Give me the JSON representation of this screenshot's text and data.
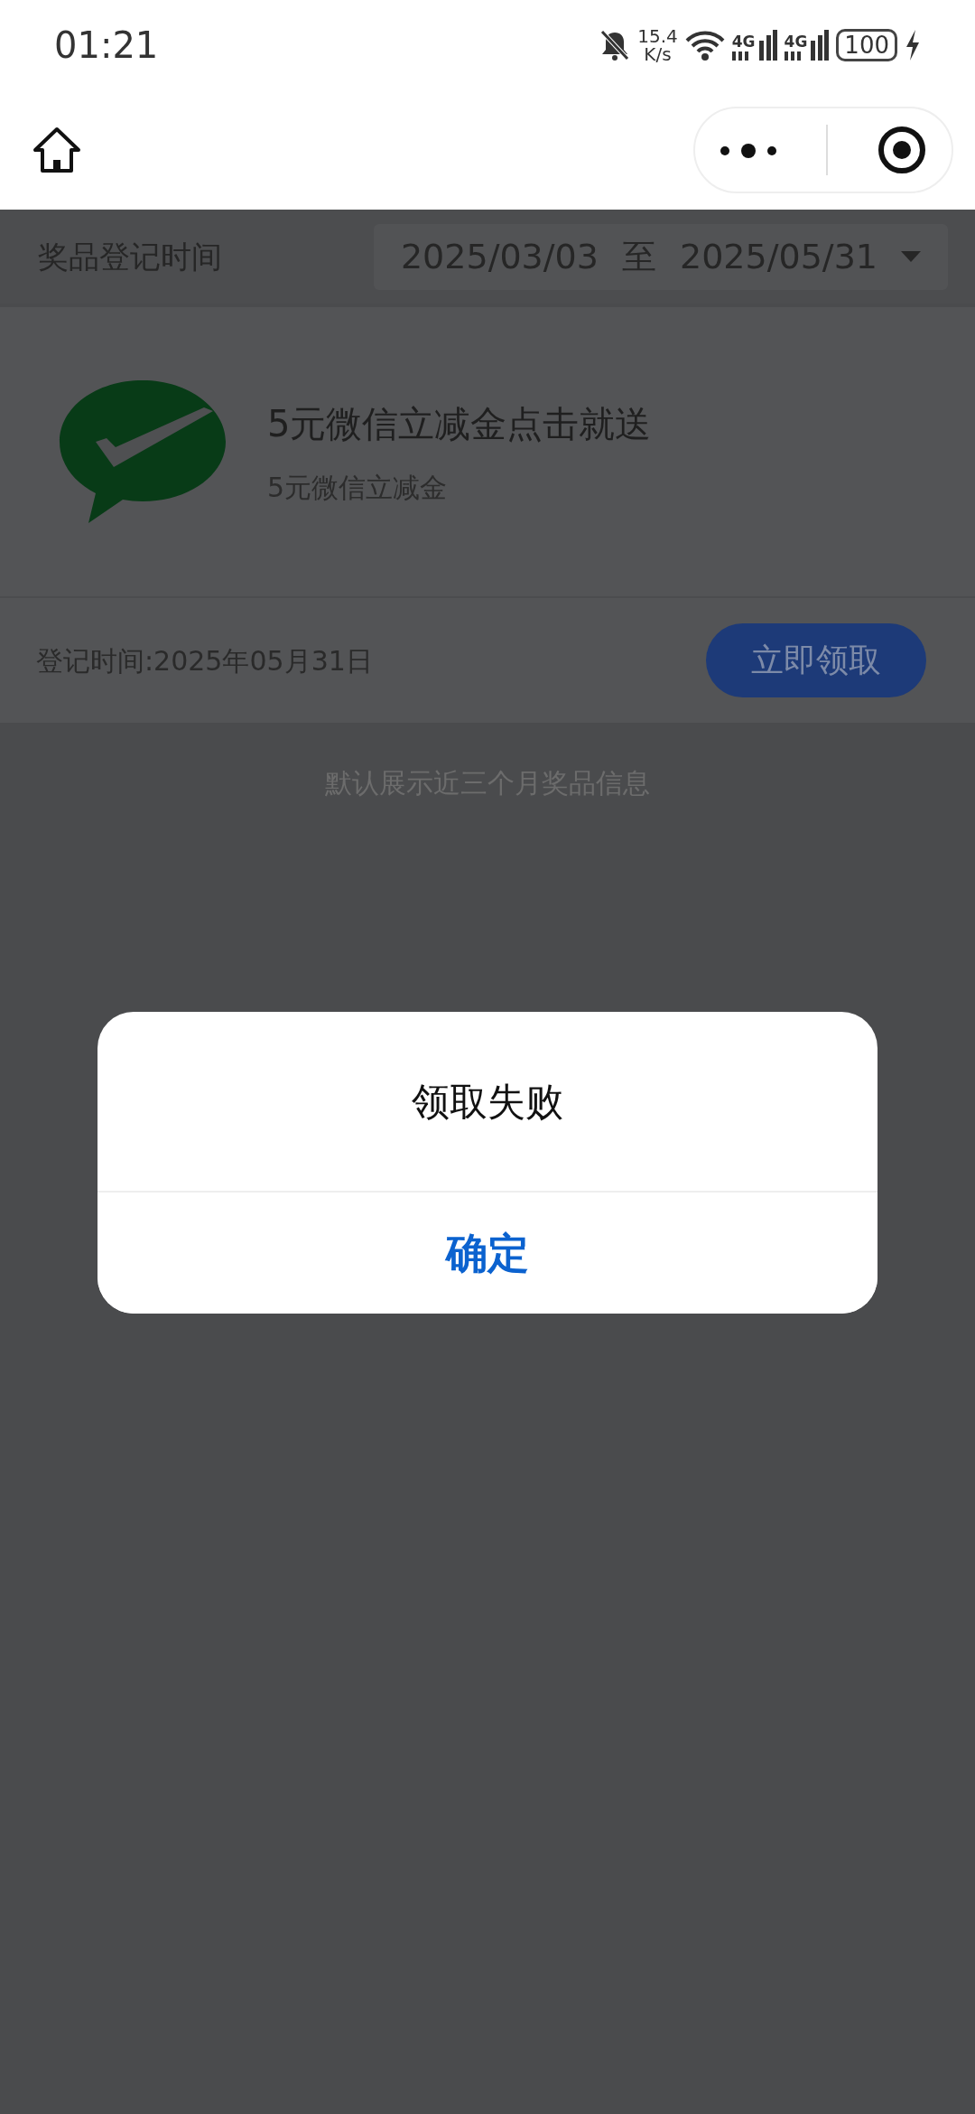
{
  "status_bar": {
    "time": "01:21",
    "net_speed": "15.4",
    "net_speed_unit": "K/s",
    "sim_1": "4G",
    "sim_2": "4G",
    "battery": "100"
  },
  "filter": {
    "label": "奖品登记时间",
    "start": "2025/03/03",
    "separator": "至",
    "end": "2025/05/31"
  },
  "prizes": [
    {
      "title": "5元微信立减金点击就送",
      "subtitle": "5元微信立减金",
      "date": "登记时间:2025年05月31日",
      "action": "立即领取"
    }
  ],
  "note": "默认展示近三个月奖品信息",
  "dialog": {
    "message": "领取失败",
    "confirm": "确定"
  }
}
